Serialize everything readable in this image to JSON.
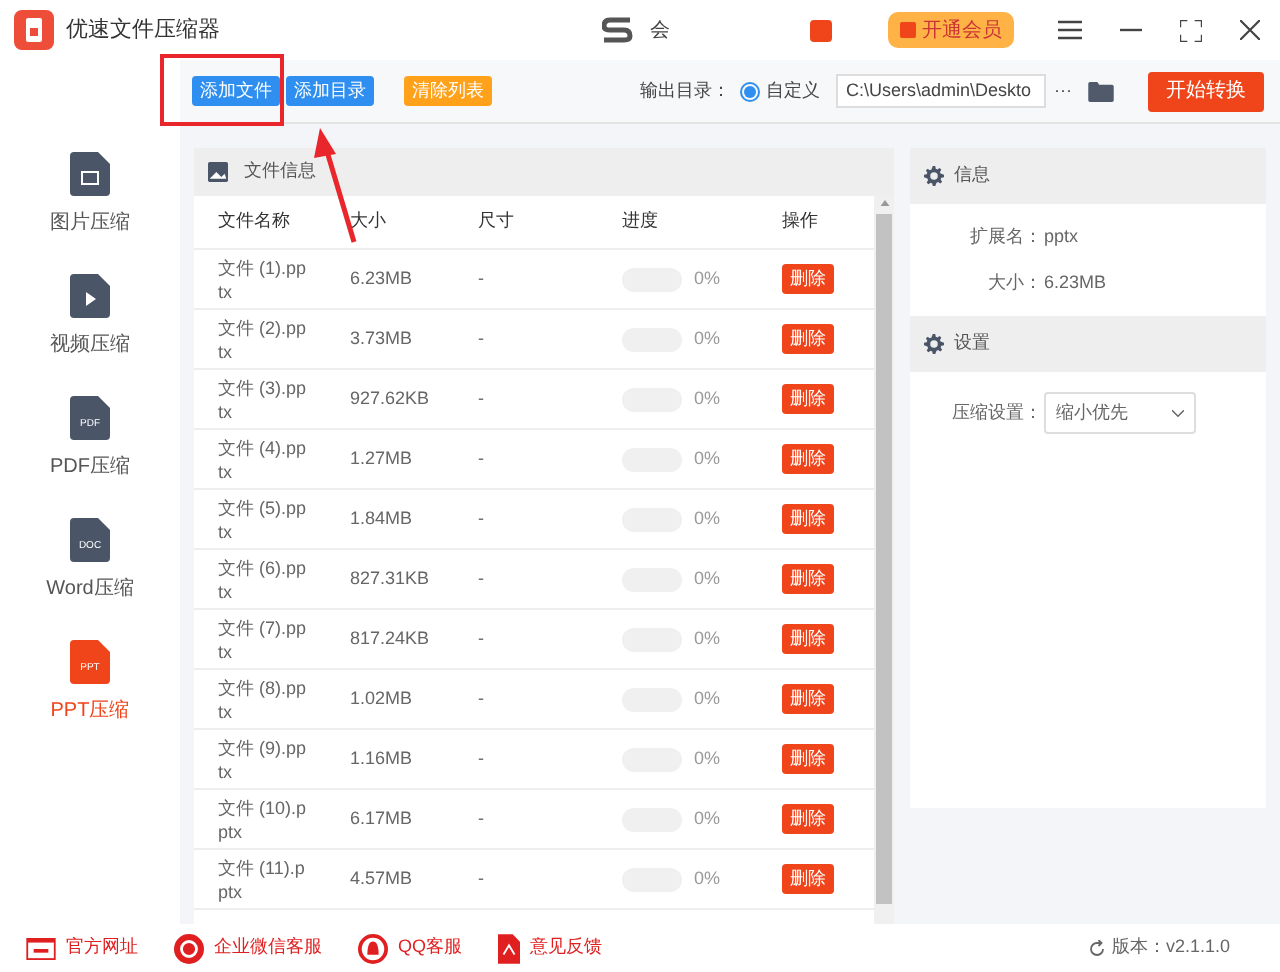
{
  "window": {
    "title": "优速文件压缩器",
    "user": "会",
    "vip_button": "开通会员"
  },
  "toolbar": {
    "buttons": [
      {
        "label": "添加文件",
        "kind": "blue"
      },
      {
        "label": "添加目录",
        "kind": "blue"
      },
      {
        "label": "清除列表",
        "kind": "orange"
      }
    ],
    "output_label": "输出目录：",
    "radio": {
      "label": "自定义",
      "selected": true
    },
    "path": "C:\\Users\\admin\\Deskto",
    "more": "···",
    "start_button": "开始转换"
  },
  "sidebar": {
    "items": [
      {
        "label": "图片压缩",
        "kind": "image",
        "selected": false
      },
      {
        "label": "视频压缩",
        "kind": "video",
        "selected": false
      },
      {
        "label": "PDF压缩",
        "kind": "doc",
        "tag": "PDF",
        "selected": false
      },
      {
        "label": "Word压缩",
        "kind": "doc",
        "tag": "DOC",
        "selected": false
      },
      {
        "label": "PPT压缩",
        "kind": "doc",
        "tag": "PPT",
        "selected": true
      }
    ]
  },
  "file_panel": {
    "title": "文件信息",
    "columns": [
      "文件名称",
      "大小",
      "尺寸",
      "进度",
      "操作"
    ],
    "rows": [
      {
        "name": "文件 (1).pptx",
        "size": "6.23MB",
        "dimension": "-",
        "level": 0,
        "progress": "0%",
        "action": "删除"
      },
      {
        "name": "文件 (2).pptx",
        "size": "3.73MB",
        "dimension": "-",
        "level": 0,
        "progress": "0%",
        "action": "删除"
      },
      {
        "name": "文件 (3).pptx",
        "size": "927.62KB",
        "dimension": "-",
        "level": 0,
        "progress": "0%",
        "action": "删除"
      },
      {
        "name": "文件 (4).pptx",
        "size": "1.27MB",
        "dimension": "-",
        "level": 0,
        "progress": "0%",
        "action": "删除"
      },
      {
        "name": "文件 (5).pptx",
        "size": "1.84MB",
        "dimension": "-",
        "level": 0,
        "progress": "0%",
        "action": "删除"
      },
      {
        "name": "文件 (6).pptx",
        "size": "827.31KB",
        "dimension": "-",
        "level": 0,
        "progress": "0%",
        "action": "删除"
      },
      {
        "name": "文件 (7).pptx",
        "size": "817.24KB",
        "dimension": "-",
        "level": 0,
        "progress": "0%",
        "action": "删除"
      },
      {
        "name": "文件 (8).pptx",
        "size": "1.02MB",
        "dimension": "-",
        "level": 0,
        "progress": "0%",
        "action": "删除"
      },
      {
        "name": "文件 (9).pptx",
        "size": "1.16MB",
        "dimension": "-",
        "level": 0,
        "progress": "0%",
        "action": "删除"
      },
      {
        "name": "文件 (10).pptx",
        "size": "6.17MB",
        "dimension": "-",
        "level": 0,
        "progress": "0%",
        "action": "删除"
      },
      {
        "name": "文件 (11).pptx",
        "size": "4.57MB",
        "dimension": "-",
        "level": 0,
        "progress": "0%",
        "action": "删除"
      }
    ]
  },
  "info_panel": {
    "title": "信息",
    "fields": [
      {
        "label": "扩展名：",
        "value": "pptx"
      },
      {
        "label": "大小：",
        "value": "6.23MB"
      }
    ]
  },
  "settings_panel": {
    "title": "设置",
    "label": "压缩设置：",
    "value": "缩小优先"
  },
  "footer": {
    "links": [
      {
        "label": "官方网址",
        "kind": "web"
      },
      {
        "label": "企业微信客服",
        "kind": "wechat"
      },
      {
        "label": "QQ客服",
        "kind": "qq"
      },
      {
        "label": "意见反馈",
        "kind": "feedback"
      }
    ],
    "version": "版本：v2.1.1.0"
  }
}
